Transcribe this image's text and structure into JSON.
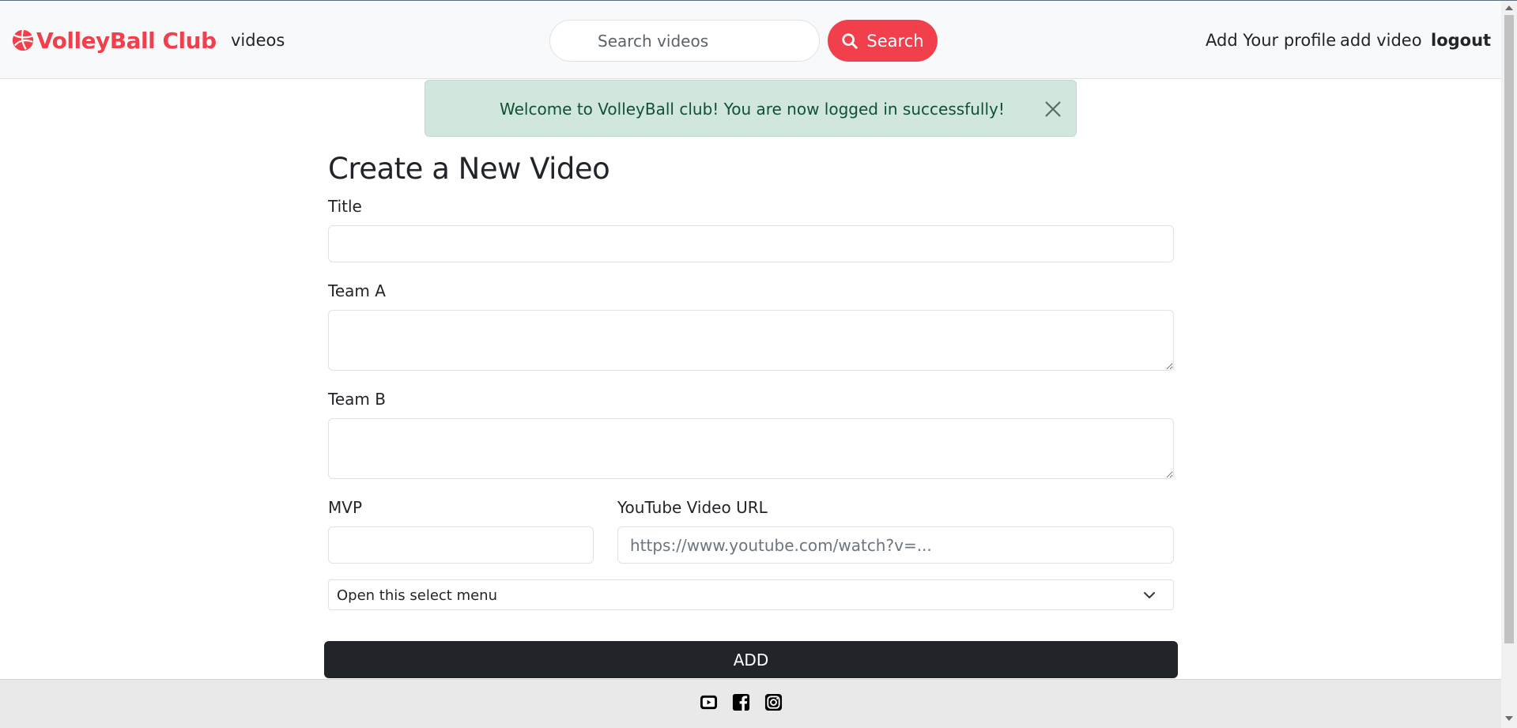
{
  "navbar": {
    "brand": "VolleyBall Club",
    "videos_link": "videos",
    "search_placeholder": "Search videos",
    "search_button": "Search",
    "add_profile": "Add Your profile",
    "add_video": "add video",
    "logout": "logout"
  },
  "alert": {
    "message": "Welcome to VolleyBall club! You are now logged in successfully!"
  },
  "form": {
    "heading": "Create a New Video",
    "title_label": "Title",
    "title_value": "",
    "team_a_label": "Team A",
    "team_a_value": "",
    "team_b_label": "Team B",
    "team_b_value": "",
    "mvp_label": "MVP",
    "mvp_value": "",
    "youtube_label": "YouTube Video URL",
    "youtube_placeholder": "https://www.youtube.com/watch?v=...",
    "select_value": "Open this select menu",
    "add_button": "ADD"
  },
  "footer": {
    "icons": [
      "youtube-icon",
      "facebook-icon",
      "instagram-icon"
    ]
  },
  "colors": {
    "brand": "#f23f4c",
    "alert_bg": "#d1e7dd",
    "alert_text": "#0f5132",
    "button_dark": "#212529"
  }
}
